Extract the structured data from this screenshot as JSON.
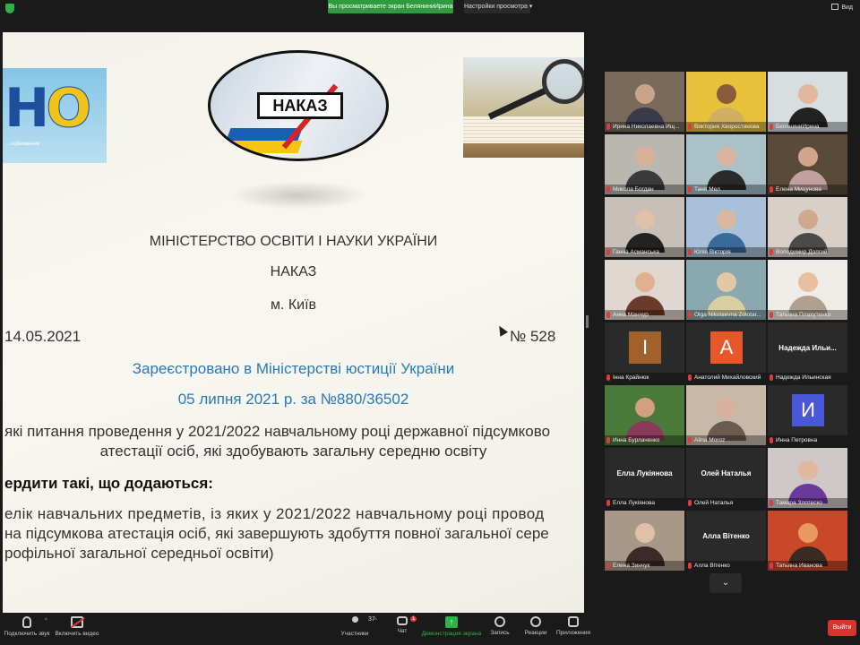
{
  "top_bar": {
    "sharing_notice": "Вы просматриваете экран БеляниниИрина",
    "view_options": "Настройки просмотра",
    "view_mode": "Вид"
  },
  "slide": {
    "left_logo": "НО",
    "left_logo_caption": "...оцінювання",
    "banner": "НАКАЗ",
    "ministry": "МІНІСТЕРСТВО ОСВІТИ І НАУКИ УКРАЇНИ",
    "order": "НАКАЗ",
    "city": "м. Київ",
    "date": "14.05.2021",
    "number": "№ 528",
    "registered_line1": "Зареєстровано в Міністерстві юстиції України",
    "registered_line2": "05 липня 2021 р. за №880/36502",
    "subject_line1": "які питання проведення у 2021/2022 навчальному році державної підсумково",
    "subject_line2": "атестації осіб, які здобувають загальну середню освіту",
    "approve": "ердити такі, що додаються:",
    "list_line1": "елік навчальних предметів, із яких у 2021/2022 навчальному році провод",
    "list_line2": "на підсумкова атестація осіб, які завершують здобуття повної загальної сере",
    "list_line3": "рофільної загальної середньої освіти)"
  },
  "participants": [
    {
      "name": "Ирина Николаевна Ищ...",
      "type": "video",
      "bg": "#7a6a5a",
      "skin": "#c9a48a",
      "cloth": "#3a3a4a"
    },
    {
      "name": "Виктория Хворостянова",
      "type": "video",
      "bg": "#e8c23a",
      "skin": "#8a5a3a",
      "cloth": "#d0b060"
    },
    {
      "name": "БеляниниИрина",
      "type": "video",
      "active": true,
      "bg": "#d8dde0",
      "skin": "#e0b8a0",
      "cloth": "#222222"
    },
    {
      "name": "Микола Богдан",
      "type": "video",
      "bg": "#b8b8b0",
      "skin": "#d8b09a",
      "cloth": "#3a3a3a"
    },
    {
      "name": "Таня Мел",
      "type": "video",
      "bg": "#a8c2c8",
      "skin": "#d9b5a0",
      "cloth": "#2a2a2a"
    },
    {
      "name": "Елена Мицунова",
      "type": "video",
      "bg": "#5a4a3a",
      "skin": "#d2a48a",
      "cloth": "#c0a0a0"
    },
    {
      "name": "Ганна Асманська",
      "type": "video",
      "bg": "#c8c0b8",
      "skin": "#e0c0a8",
      "cloth": "#222222"
    },
    {
      "name": "Юлія Вікторія",
      "type": "video",
      "bg": "#a8c0d8",
      "skin": "#d8b8a0",
      "cloth": "#3a6a9a"
    },
    {
      "name": "Володимир Долгий",
      "type": "video",
      "bg": "#d8d0c8",
      "skin": "#d0a890",
      "cloth": "#4a4a4a"
    },
    {
      "name": "Анна Манчур",
      "type": "video",
      "bg": "#e0d8d0",
      "skin": "#e0b090",
      "cloth": "#6a3a2a"
    },
    {
      "name": "Olga Nikolaevna Zolotar...",
      "type": "video",
      "bg": "#8aa8b0",
      "skin": "#e0c8a8",
      "cloth": "#d8d0a0"
    },
    {
      "name": "Татьяна Плахутенко",
      "type": "video",
      "bg": "#f0ece8",
      "skin": "#e8c0a0",
      "cloth": "#b0a090"
    },
    {
      "name": "Інна Крайнюк",
      "type": "letter",
      "letter": "I",
      "color": "#a0622a"
    },
    {
      "name": "Анатолий Михайловский",
      "type": "letter",
      "letter": "А",
      "color": "#e8572a"
    },
    {
      "name": "Надежда Ильинская",
      "type": "text",
      "big": "Надежда Ильи..."
    },
    {
      "name": "Инна Бурлаченко",
      "type": "video",
      "bg": "#4a7a3a",
      "skin": "#d0a080",
      "cloth": "#8a3a5a"
    },
    {
      "name": "Alina Moroz",
      "type": "video",
      "bg": "#c8b8a8",
      "skin": "#d8b0a0",
      "cloth": "#6a5a50"
    },
    {
      "name": "Инна Петровна",
      "type": "letter",
      "letter": "И",
      "color": "#4a58d8"
    },
    {
      "name": "Елла Лукіянова",
      "type": "text",
      "big": "Елла Лукіянова"
    },
    {
      "name": "Олей Наталья",
      "type": "text",
      "big": "Олей Наталья"
    },
    {
      "name": "Тамара Злотеско",
      "type": "video",
      "bg": "#d0c8c8",
      "skin": "#e0b8a0",
      "cloth": "#6a3a9a"
    },
    {
      "name": "Елена Зинчук",
      "type": "video",
      "bg": "#a89888",
      "skin": "#e0c0a8",
      "cloth": "#3a2a2a"
    },
    {
      "name": "Алла Вітенко",
      "type": "text",
      "big": "Алла Вітенко"
    },
    {
      "name": "Татьяна Иванова",
      "type": "video",
      "bg": "#c84828",
      "skin": "#e89860",
      "cloth": "#3a2a20"
    }
  ],
  "toolbar": {
    "audio": "Подключить звук",
    "video": "Включить видео",
    "participants": "Участники",
    "participants_count": "37",
    "chat": "Чат",
    "chat_badge": "1",
    "share": "Демонстрация экрана",
    "record": "Запись",
    "reactions": "Реакции",
    "apps": "Приложения",
    "leave": "Выйти"
  }
}
